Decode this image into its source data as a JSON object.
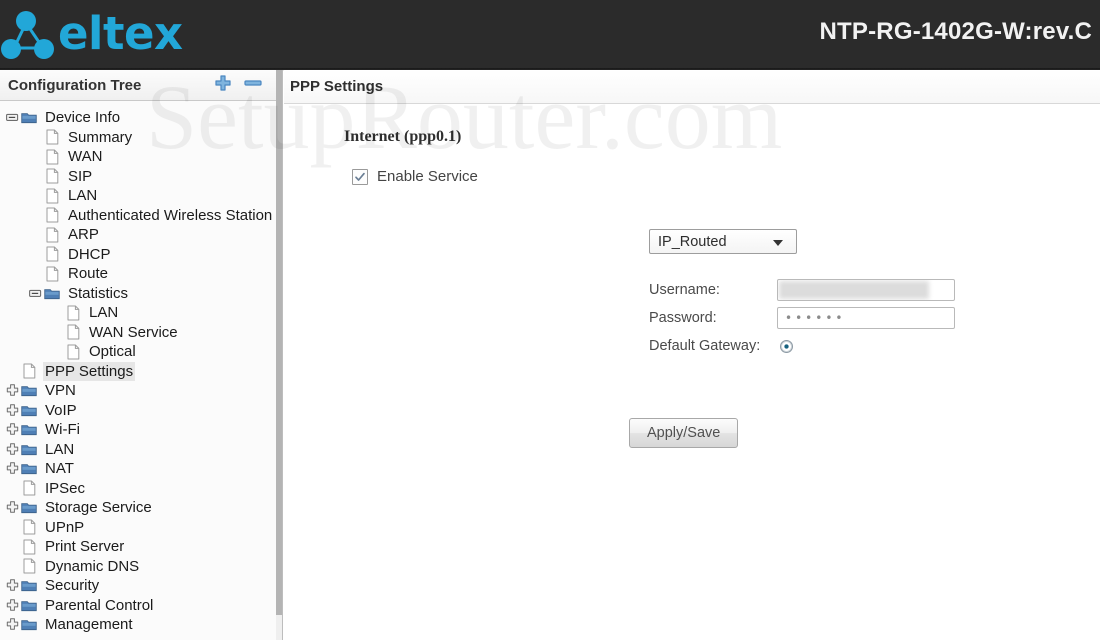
{
  "header": {
    "brand_name": "eltex",
    "brand_logo_icon": "eltex-molecule-logo",
    "device_title": "NTP-RG-1402G-W:rev.C",
    "brand_color": "#22a7d8",
    "bar_color": "#2b2b2b"
  },
  "watermark": {
    "text": "SetupRouter.com"
  },
  "sidebar": {
    "title": "Configuration Tree",
    "expand_all_icon": "plus-icon",
    "collapse_all_icon": "minus-icon",
    "tree": [
      {
        "label": "Device Info",
        "indent": 0,
        "icon": "folder-icon",
        "expander": "minus",
        "selected": false
      },
      {
        "label": "Summary",
        "indent": 1,
        "icon": "page-icon",
        "expander": "none",
        "selected": false
      },
      {
        "label": "WAN",
        "indent": 1,
        "icon": "page-icon",
        "expander": "none",
        "selected": false
      },
      {
        "label": "SIP",
        "indent": 1,
        "icon": "page-icon",
        "expander": "none",
        "selected": false
      },
      {
        "label": "LAN",
        "indent": 1,
        "icon": "page-icon",
        "expander": "none",
        "selected": false
      },
      {
        "label": "Authenticated Wireless Station",
        "indent": 1,
        "icon": "page-icon",
        "expander": "none",
        "selected": false
      },
      {
        "label": "ARP",
        "indent": 1,
        "icon": "page-icon",
        "expander": "none",
        "selected": false
      },
      {
        "label": "DHCP",
        "indent": 1,
        "icon": "page-icon",
        "expander": "none",
        "selected": false
      },
      {
        "label": "Route",
        "indent": 1,
        "icon": "page-icon",
        "expander": "none",
        "selected": false
      },
      {
        "label": "Statistics",
        "indent": 1,
        "icon": "folder-icon",
        "expander": "minus",
        "selected": false
      },
      {
        "label": "LAN",
        "indent": 2,
        "icon": "page-icon",
        "expander": "none",
        "selected": false
      },
      {
        "label": "WAN Service",
        "indent": 2,
        "icon": "page-icon",
        "expander": "none",
        "selected": false
      },
      {
        "label": "Optical",
        "indent": 2,
        "icon": "page-icon",
        "expander": "none",
        "selected": false
      },
      {
        "label": "PPP Settings",
        "indent": 0,
        "icon": "page-icon",
        "expander": "none",
        "selected": true
      },
      {
        "label": "VPN",
        "indent": 0,
        "icon": "folder-icon",
        "expander": "plus",
        "selected": false
      },
      {
        "label": "VoIP",
        "indent": 0,
        "icon": "folder-icon",
        "expander": "plus",
        "selected": false
      },
      {
        "label": "Wi-Fi",
        "indent": 0,
        "icon": "folder-icon",
        "expander": "plus",
        "selected": false
      },
      {
        "label": "LAN",
        "indent": 0,
        "icon": "folder-icon",
        "expander": "plus",
        "selected": false
      },
      {
        "label": "NAT",
        "indent": 0,
        "icon": "folder-icon",
        "expander": "plus",
        "selected": false
      },
      {
        "label": "IPSec",
        "indent": 0,
        "icon": "page-icon",
        "expander": "none",
        "selected": false
      },
      {
        "label": "Storage Service",
        "indent": 0,
        "icon": "folder-icon",
        "expander": "plus",
        "selected": false
      },
      {
        "label": "UPnP",
        "indent": 0,
        "icon": "page-icon",
        "expander": "none",
        "selected": false
      },
      {
        "label": "Print Server",
        "indent": 0,
        "icon": "page-icon",
        "expander": "none",
        "selected": false
      },
      {
        "label": "Dynamic DNS",
        "indent": 0,
        "icon": "page-icon",
        "expander": "none",
        "selected": false
      },
      {
        "label": "Security",
        "indent": 0,
        "icon": "folder-icon",
        "expander": "plus",
        "selected": false
      },
      {
        "label": "Parental Control",
        "indent": 0,
        "icon": "folder-icon",
        "expander": "plus",
        "selected": false
      },
      {
        "label": "Management",
        "indent": 0,
        "icon": "folder-icon",
        "expander": "plus",
        "selected": false
      }
    ]
  },
  "content": {
    "panel_title": "PPP Settings",
    "section_title": "Internet (ppp0.1)",
    "enable_service": {
      "label": "Enable Service",
      "checked": true
    },
    "mode_select": {
      "value": "IP_Routed",
      "options": [
        "IP_Routed"
      ]
    },
    "fields": {
      "username_label": "Username:",
      "username_value": "",
      "password_label": "Password:",
      "password_value": "••••••",
      "default_gateway_label": "Default Gateway:",
      "default_gateway_selected": true
    },
    "apply_button_label": "Apply/Save"
  }
}
